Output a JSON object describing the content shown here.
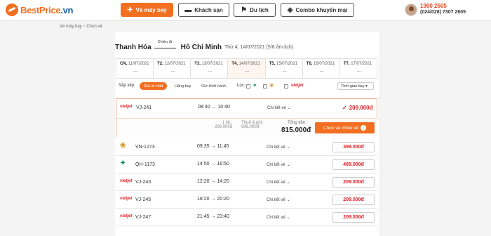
{
  "brand": {
    "name_part1": "BestPrice",
    "name_part2": ".vn"
  },
  "nav": {
    "flights": "Vé máy bay",
    "hotels": "Khách sạn",
    "travel": "Du lịch",
    "promo": "Combo khuyến mại"
  },
  "contact": {
    "hotline": "1900 2605",
    "phone": "(024/028) 7307 2605"
  },
  "breadcrumb": {
    "home": "Vé máy bay",
    "separator": ">",
    "current": "Chọn vé"
  },
  "route": {
    "from": "Thanh Hóa",
    "direction": "Chiều đi",
    "to": "Hồ Chí Minh",
    "date": "Thứ 4, 14/07/2021 (5/6 âm lịch)"
  },
  "days": [
    {
      "dow": "CN,",
      "date": "11/07/2021",
      "price": "---"
    },
    {
      "dow": "T2,",
      "date": "12/07/2021",
      "price": "---"
    },
    {
      "dow": "T3,",
      "date": "13/07/2021",
      "price": "---"
    },
    {
      "dow": "T4,",
      "date": "14/07/2021",
      "price": "---"
    },
    {
      "dow": "T5,",
      "date": "15/07/2021",
      "price": "---"
    },
    {
      "dow": "T6,",
      "date": "16/07/2021",
      "price": "---"
    },
    {
      "dow": "T7,",
      "date": "17/07/2021",
      "price": "---"
    }
  ],
  "filters": {
    "sort_label": "Sắp xếp:",
    "cheapest": "Giá rẻ nhất",
    "airline": "Hãng bay",
    "departure": "Giờ khởi hành",
    "filter_label": "Lọc:",
    "vietjet": "vietjet",
    "sort_select": "Thời gian bay"
  },
  "selected": {
    "airline": "vietjet",
    "flight": "VJ-241",
    "time": "08:40 → 10:40",
    "detail": "Chi tiết vé",
    "price": "209.000đ",
    "qty_label": "1 NL:",
    "qty_price": "209.000đ",
    "fee_label": "Thuế & phí:",
    "fee_value": "606.000đ",
    "total_label": "Tổng tiền:",
    "total": "815.000đ",
    "choose": "Chọn vé chiều về"
  },
  "flights": [
    {
      "airline": "vietnam-airlines",
      "flight": "VN-1273",
      "time": "09:35 → 11:45",
      "detail": "Chi tiết vé",
      "price": "399.000đ"
    },
    {
      "airline": "bamboo",
      "flight": "QH-1173",
      "time": "14:50 → 16:50",
      "detail": "Chi tiết vé",
      "price": "499.000đ"
    },
    {
      "airline": "vietjet",
      "flight": "VJ-243",
      "time": "12:20 → 14:20",
      "detail": "Chi tiết vé",
      "price": "209.000đ"
    },
    {
      "airline": "vietjet",
      "flight": "VJ-245",
      "time": "18:20 → 20:20",
      "detail": "Chi tiết vé",
      "price": "209.000đ"
    },
    {
      "airline": "vietjet",
      "flight": "VJ-247",
      "time": "21:45 → 23:40",
      "detail": "Chi tiết vé",
      "price": "209.000đ"
    }
  ],
  "colors": {
    "brand_orange": "#f26f21",
    "price_red": "#e31e24",
    "brand_blue": "#1a5ea8"
  }
}
